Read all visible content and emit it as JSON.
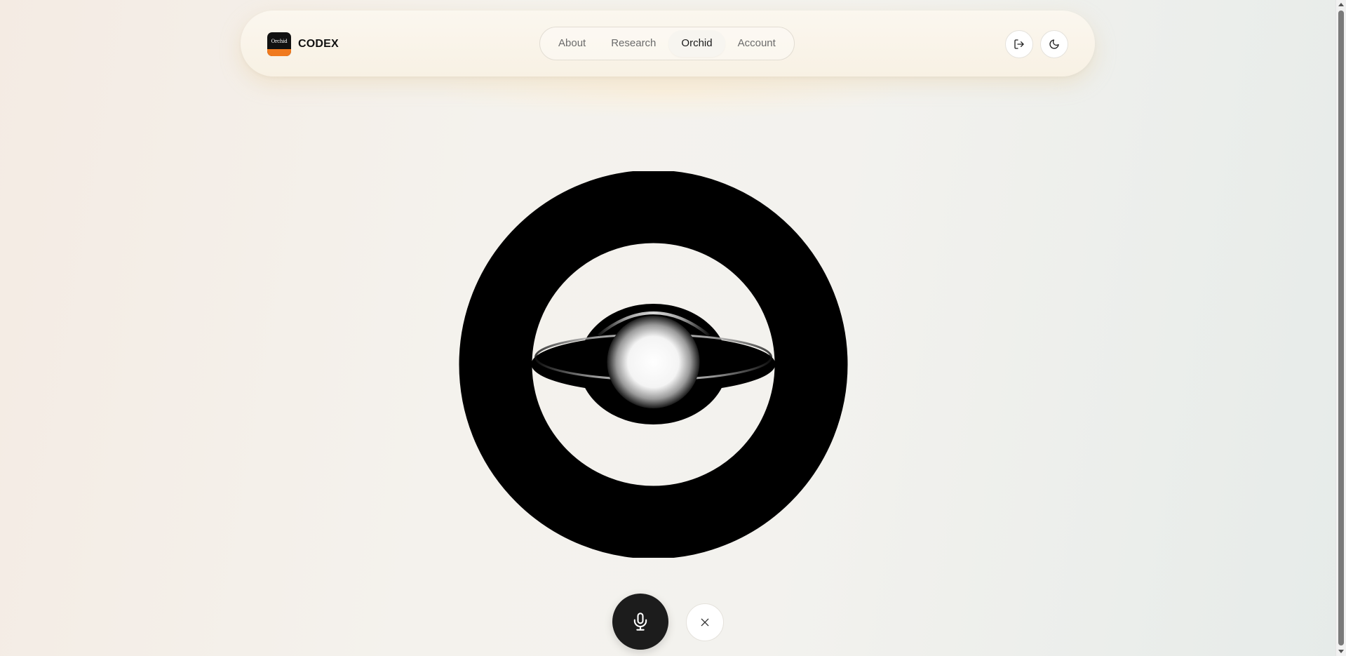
{
  "header": {
    "logo_text": "Orchid",
    "brand_name": "CODEX",
    "nav": [
      {
        "label": "About"
      },
      {
        "label": "Research"
      },
      {
        "label": "Orchid"
      },
      {
        "label": "Account"
      }
    ],
    "active_nav": "Orchid",
    "icons": {
      "logout": "logout-icon",
      "theme": "moon-icon"
    }
  },
  "controls": {
    "mic_icon": "microphone-icon",
    "close_icon": "close-icon"
  },
  "colors": {
    "logo_accent": "#f07a1f",
    "mic_button": "#1c1c1c",
    "orb": "#000000"
  }
}
